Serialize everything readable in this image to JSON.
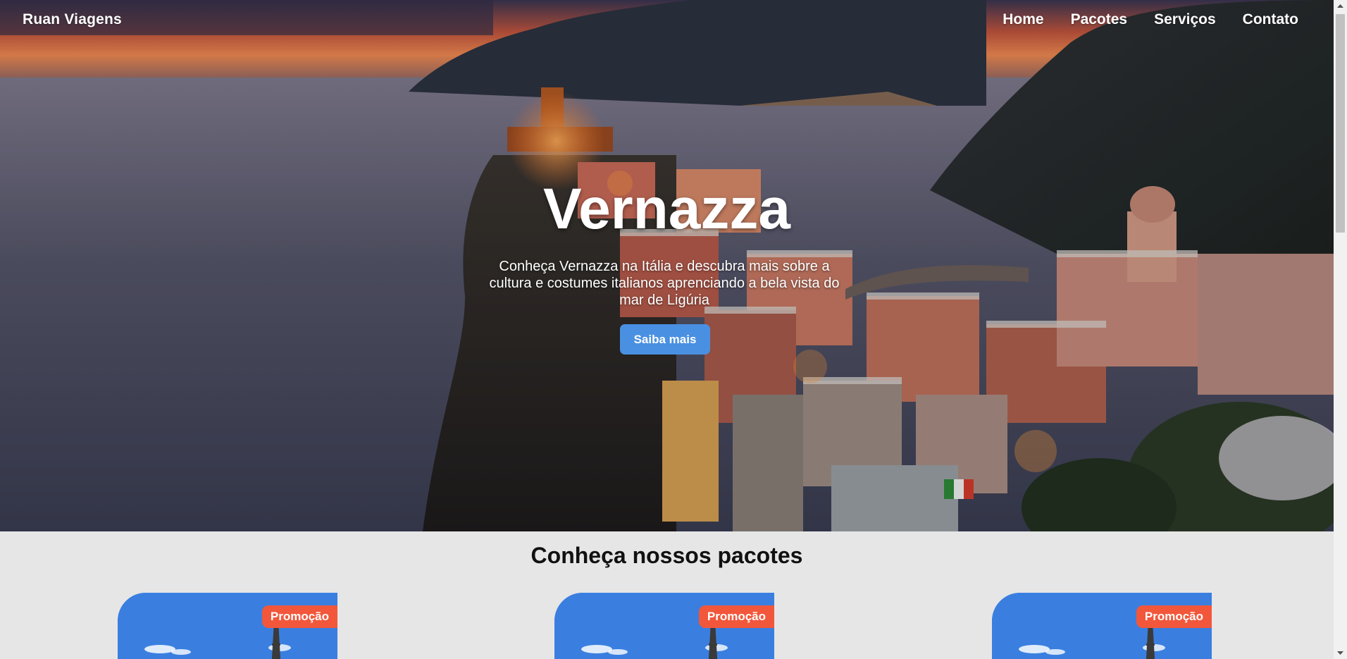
{
  "nav": {
    "brand": "Ruan Viagens",
    "links": [
      "Home",
      "Pacotes",
      "Serviços",
      "Contato"
    ]
  },
  "hero": {
    "title": "Vernazza",
    "description": "Conheça Vernazza na Itália e descubra mais sobre a cultura e costumes italianos aprenciando a bela vista do mar de Ligúria",
    "button_label": "Saiba mais"
  },
  "packages": {
    "title": "Conheça nossos pacotes",
    "cards": [
      {
        "badge": "Promoção"
      },
      {
        "badge": "Promoção"
      },
      {
        "badge": "Promoção"
      }
    ]
  },
  "colors": {
    "button": "#4a90e2",
    "badge": "#f2573b",
    "section_bg": "#e6e6e6"
  }
}
